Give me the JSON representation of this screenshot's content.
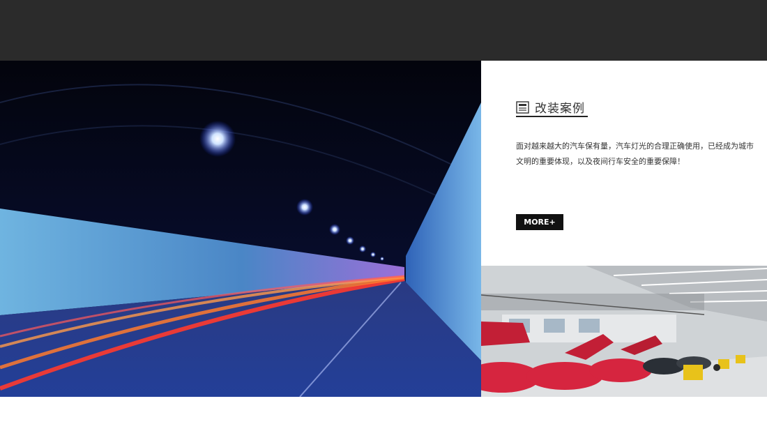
{
  "case": {
    "title": "改装案例",
    "description": "面对越来越大的汽车保有量，汽车灯光的合理正确使用，已经成为城市文明的重要体现，以及夜间行车安全的重要保障！",
    "more_label": "MORE+"
  },
  "icons": {
    "case_icon": "newspaper-icon"
  },
  "colors": {
    "header_bg": "#2b2b2b",
    "button_bg": "#111111",
    "accent_car": "#d6253f"
  }
}
